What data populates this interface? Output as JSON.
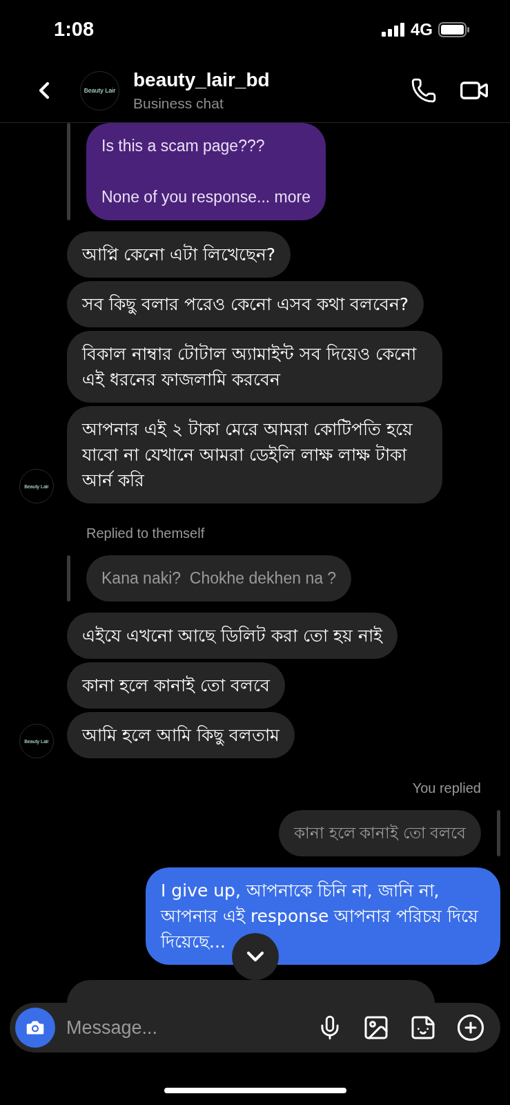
{
  "status_bar": {
    "time": "1:08",
    "network": "4G"
  },
  "header": {
    "title": "beauty_lair_bd",
    "subtitle": "Business chat",
    "avatar_label": "Beauty Lair"
  },
  "messages": [
    {
      "kind": "quote",
      "outgoing": false,
      "color": "#4b227a",
      "text": "Is this a scam page???\n\nNone of you response... more"
    },
    {
      "kind": "text",
      "outgoing": false,
      "text": "আপ্নি কেনো এটা লিখেছেন?"
    },
    {
      "kind": "text",
      "outgoing": false,
      "text": "সব কিছু বলার পরেও কেনো এসব কথা বলবেন?"
    },
    {
      "kind": "text",
      "outgoing": false,
      "text": "বিকাল নাম্বার টোটাল অ্যামাইন্ট সব দিয়েও কেনো এই ধরনের ফাজলামি করবেন"
    },
    {
      "kind": "text",
      "outgoing": false,
      "text": "আপনার এই ২ টাকা মেরে আমরা কোটিপতি হয়ে যাবো না যেখানে আমরা ডেইলি লাক্ষ লাক্ষ টাকা আর্ন করি",
      "avatar_label": "Beauty Lair"
    },
    {
      "kind": "label",
      "outgoing": false,
      "text": "Replied to themself"
    },
    {
      "kind": "quote",
      "outgoing": false,
      "color": "#262626",
      "text": "Kana naki?  Chokhe dekhen na ?"
    },
    {
      "kind": "text",
      "outgoing": false,
      "text": "এইযে এখনো আছে ডিলিট করা তো হয় নাই"
    },
    {
      "kind": "text",
      "outgoing": false,
      "text": "কানা হলে কানাই তো বলবে"
    },
    {
      "kind": "text",
      "outgoing": false,
      "text": "আমি হলে আমি কিছু বলতাম",
      "avatar_label": "Beauty Lair"
    },
    {
      "kind": "label",
      "outgoing": true,
      "text": "You replied"
    },
    {
      "kind": "quote",
      "outgoing": true,
      "color": "#262626",
      "text": "কানা হলে কানাই তো বলবে"
    },
    {
      "kind": "text",
      "outgoing": true,
      "text": "I give up, আপনাকে চিনি না, জানি না, আপনার এই response আপনার পরিচয় দিয়ে দিয়েছে..."
    },
    {
      "kind": "cut_off",
      "outgoing": false
    }
  ],
  "composer": {
    "placeholder": "Message..."
  }
}
